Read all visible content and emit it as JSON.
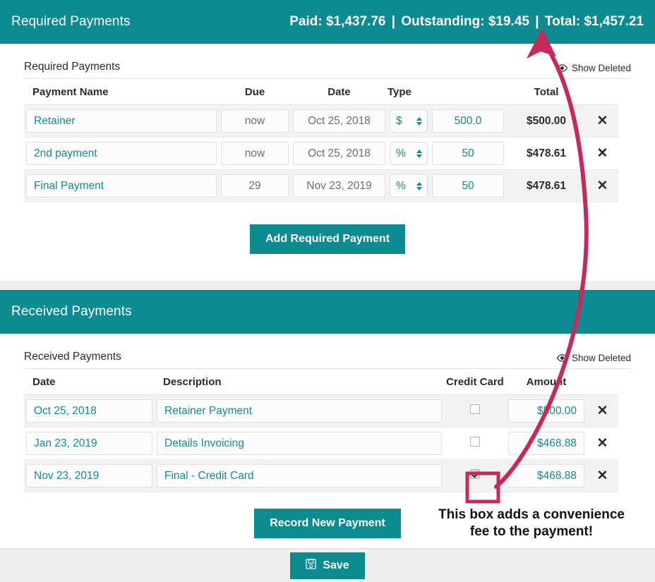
{
  "accent_color": "#0c8b91",
  "annotation_color": "#c42a5c",
  "link_color": "#128b91",
  "required_panel": {
    "header_title": "Required Payments",
    "totals": {
      "paid_label": "Paid:",
      "paid_value": "$1,437.76",
      "separator": "|",
      "outstanding_label": "Outstanding:",
      "outstanding_value": "$19.45",
      "total_label": "Total:",
      "total_value": "$1,457.21"
    },
    "subhead_title": "Required Payments",
    "show_deleted_label": "Show Deleted",
    "columns": [
      "Payment Name",
      "Due",
      "Date",
      "Type",
      "",
      "Total",
      ""
    ],
    "rows": [
      {
        "name": "Retainer",
        "due": "now",
        "date": "Oct 25, 2018",
        "type": "$",
        "amount": "500.0",
        "total": "$500.00",
        "delete_label": "✕"
      },
      {
        "name": "2nd payment",
        "due": "now",
        "date": "Oct 25, 2018",
        "type": "%",
        "amount": "50",
        "total": "$478.61",
        "delete_label": "✕"
      },
      {
        "name": "Final Payment",
        "due": "29",
        "date": "Nov 23, 2019",
        "type": "%",
        "amount": "50",
        "total": "$478.61",
        "delete_label": "✕"
      }
    ],
    "add_button_label": "Add Required Payment"
  },
  "received_panel": {
    "header_title": "Received Payments",
    "subhead_title": "Received Payments",
    "show_deleted_label": "Show Deleted",
    "columns": [
      "Date",
      "Description",
      "Credit Card",
      "Amount",
      ""
    ],
    "rows": [
      {
        "date": "Oct 25, 2018",
        "description": "Retainer Payment",
        "credit_card": false,
        "amount": "$500.00",
        "delete_label": "✕"
      },
      {
        "date": "Jan 23, 2019",
        "description": "Details Invoicing",
        "credit_card": false,
        "amount": "$468.88",
        "delete_label": "✕"
      },
      {
        "date": "Nov 23, 2019",
        "description": "Final - Credit Card",
        "credit_card": true,
        "amount": "$468.88",
        "delete_label": "✕"
      }
    ],
    "record_button_label": "Record New Payment"
  },
  "footer": {
    "save_label": "Save"
  },
  "annotation": {
    "line1": "This box adds a convenience",
    "line2": "fee to the payment!"
  }
}
